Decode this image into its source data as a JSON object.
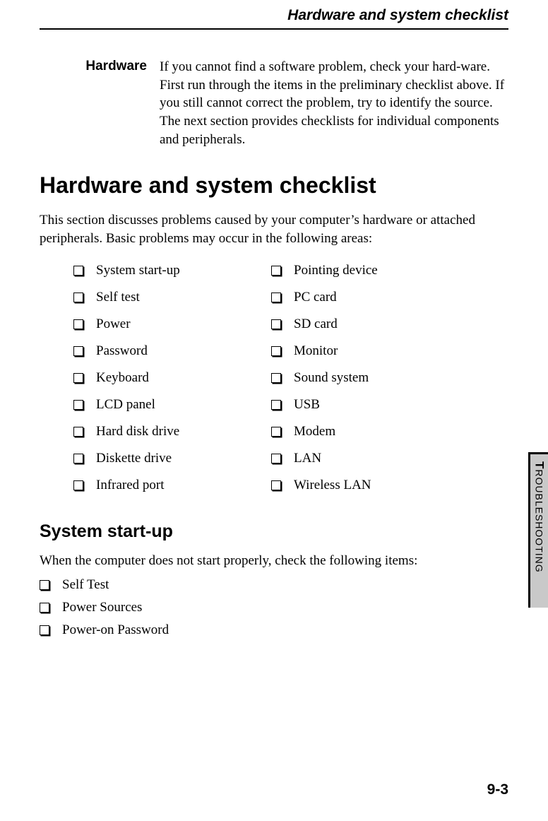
{
  "running_head": "Hardware and system checklist",
  "hardware": {
    "label": "Hardware",
    "body": "If you cannot find a software problem, check your hard-ware. First run through the items in the preliminary checklist above. If you still cannot correct the problem, try to identify the source. The next section provides checklists for individual components and peripherals."
  },
  "h1": "Hardware and system checklist",
  "intro": "This section discusses problems caused by your computer’s hardware or attached peripherals. Basic problems may occur in the following areas:",
  "checklist": {
    "left": [
      "System start-up",
      "Self test",
      "Power",
      "Password",
      "Keyboard",
      "LCD panel",
      "Hard disk drive",
      "Diskette drive",
      "Infrared port"
    ],
    "right": [
      "Pointing device",
      "PC card",
      "SD card",
      "Monitor",
      "Sound system",
      "USB",
      "Modem",
      "LAN",
      "Wireless LAN"
    ]
  },
  "h2": "System start-up",
  "sub_intro": "When the computer does not start properly, check the following items:",
  "sub_list": [
    "Self Test",
    "Power Sources",
    "Power-on Password"
  ],
  "side_tab": {
    "first": "T",
    "rest": "ROUBLESHOOTING"
  },
  "page_number": "9-3"
}
